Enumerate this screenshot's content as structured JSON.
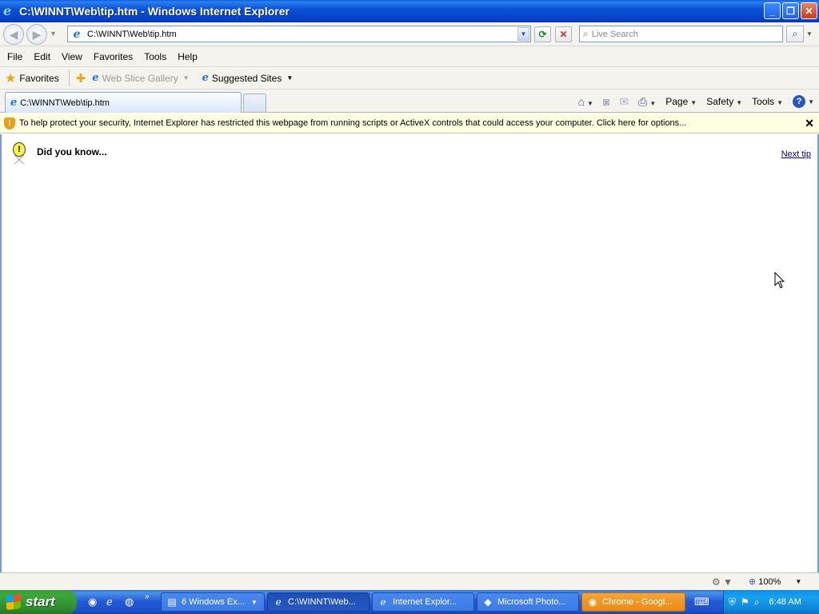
{
  "window": {
    "title": "C:\\WINNT\\Web\\tip.htm - Windows Internet Explorer",
    "buttons": {
      "minimize": "_",
      "restore": "❐",
      "close": "✕"
    }
  },
  "address_bar": {
    "url": "C:\\WINNT\\Web\\tip.htm",
    "search_placeholder": "Live Search"
  },
  "menu": {
    "items": [
      "File",
      "Edit",
      "View",
      "Favorites",
      "Tools",
      "Help"
    ]
  },
  "favorites_bar": {
    "favorites_label": "Favorites",
    "items": [
      {
        "label": "Web Slice Gallery",
        "enabled": false
      },
      {
        "label": "Suggested Sites",
        "enabled": true
      }
    ]
  },
  "tabs": [
    {
      "label": "C:\\WINNT\\Web\\tip.htm",
      "active": true
    }
  ],
  "command_bar": {
    "page_label": "Page",
    "safety_label": "Safety",
    "tools_label": "Tools"
  },
  "info_bar": {
    "message": "To help protect your security, Internet Explorer has restricted this webpage from running scripts or ActiveX controls that could access your computer. Click here for options..."
  },
  "content": {
    "heading": "Did you know...",
    "next_link": "Next tip"
  },
  "status_bar": {
    "zoom": "100%"
  },
  "taskbar": {
    "start_label": "start",
    "tasks": [
      {
        "label": "6 Windows Ex...",
        "active": false,
        "icon": "folder-icon"
      },
      {
        "label": "C:\\WINNT\\Web...",
        "active": true,
        "icon": "ie-icon"
      },
      {
        "label": "Internet Explor...",
        "active": false,
        "icon": "ie-icon"
      },
      {
        "label": "Microsoft Photo...",
        "active": false,
        "icon": "photo-icon"
      },
      {
        "label": "Chrome - Googl...",
        "active": false,
        "icon": "chrome-icon"
      }
    ],
    "clock": "6:48 AM"
  },
  "colors": {
    "titlebar_blue": "#0953d6",
    "infobar_yellow": "#ffffe1",
    "start_green": "#3ba83b",
    "tray_blue": "#18a1ee"
  }
}
